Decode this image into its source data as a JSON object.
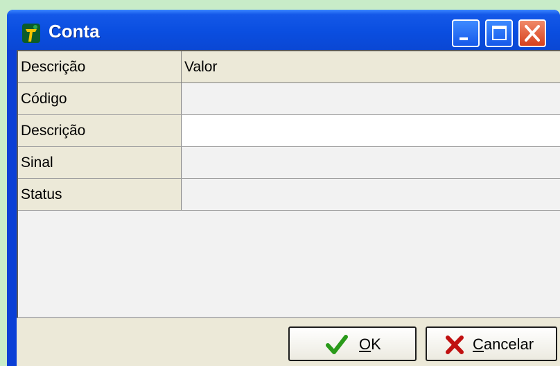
{
  "window": {
    "title": "Conta",
    "icons": {
      "app": "app-logo-icon",
      "minimize": "minimize-icon",
      "maximize": "maximize-icon",
      "close": "close-icon"
    }
  },
  "grid": {
    "columns": [
      "Descrição",
      "Valor"
    ],
    "rows": [
      {
        "label": "Código",
        "value": ""
      },
      {
        "label": "Descrição",
        "value": ""
      },
      {
        "label": "Sinal",
        "value": ""
      },
      {
        "label": "Status",
        "value": ""
      }
    ]
  },
  "buttons": {
    "ok": {
      "mnemonic": "O",
      "rest": "K",
      "icon": "checkmark-icon"
    },
    "cancel": {
      "mnemonic": "C",
      "rest": "ancelar",
      "icon": "cross-icon"
    }
  },
  "colors": {
    "titlebar": "#0a4ee0",
    "client": "#ece9d8",
    "close": "#d6401c",
    "ok_check": "#2a9a1a",
    "cancel_x": "#c01010"
  }
}
